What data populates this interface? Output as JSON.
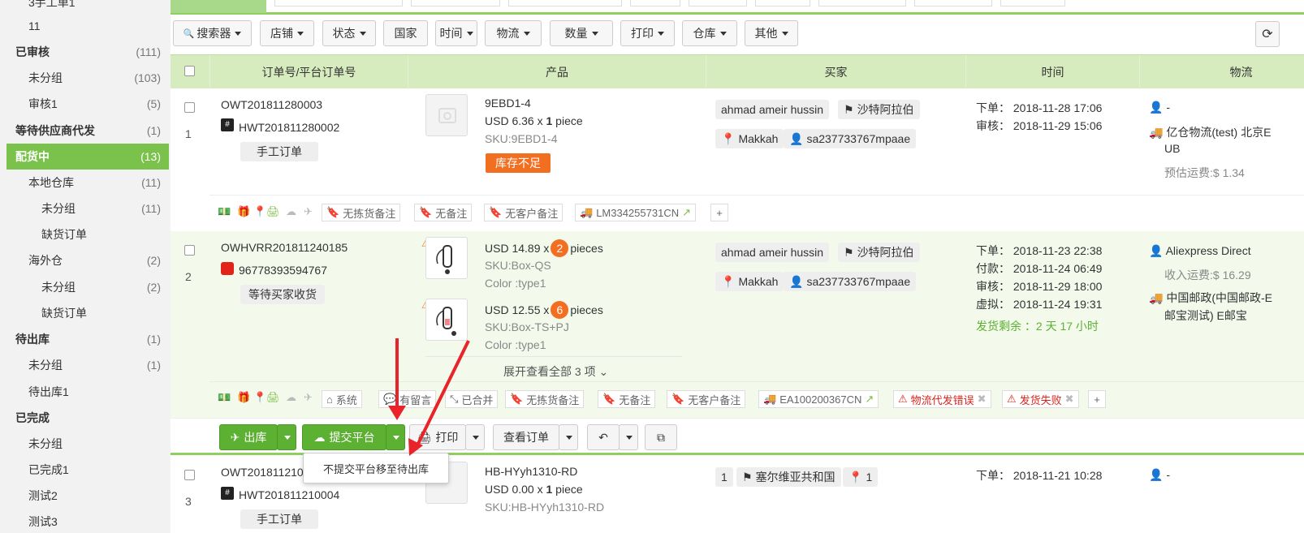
{
  "sidebar": {
    "items": [
      {
        "label": "3手工单1",
        "count": "",
        "level": 2
      },
      {
        "label": "11",
        "count": "",
        "level": 2
      },
      {
        "label": "已审核",
        "count": "(111)",
        "level": 1
      },
      {
        "label": "未分组",
        "count": "(103)",
        "level": 2
      },
      {
        "label": "审核1",
        "count": "(5)",
        "level": 2
      },
      {
        "label": "等待供应商代发",
        "count": "(1)",
        "level": 1
      },
      {
        "label": "配货中",
        "count": "(13)",
        "level": 1,
        "active": true
      },
      {
        "label": "本地仓库",
        "count": "(11)",
        "level": 2
      },
      {
        "label": "未分组",
        "count": "(11)",
        "level": 3
      },
      {
        "label": "缺货订单",
        "count": "",
        "level": 3
      },
      {
        "label": "海外仓",
        "count": "(2)",
        "level": 2
      },
      {
        "label": "未分组",
        "count": "(2)",
        "level": 3
      },
      {
        "label": "缺货订单",
        "count": "",
        "level": 3
      },
      {
        "label": "待出库",
        "count": "(1)",
        "level": 1
      },
      {
        "label": "未分组",
        "count": "(1)",
        "level": 2
      },
      {
        "label": "待出库1",
        "count": "",
        "level": 2
      },
      {
        "label": "已完成",
        "count": "",
        "level": 1
      },
      {
        "label": "未分组",
        "count": "",
        "level": 2
      },
      {
        "label": "已完成1",
        "count": "",
        "level": 2
      },
      {
        "label": "测试2",
        "count": "",
        "level": 2
      },
      {
        "label": "测试3",
        "count": "",
        "level": 2
      }
    ]
  },
  "filters": [
    "搜索器",
    "店铺",
    "状态",
    "国家",
    "时间",
    "物流",
    "数量",
    "打印",
    "仓库",
    "其他"
  ],
  "columns": [
    "订单号/平台订单号",
    "产品",
    "买家",
    "时间",
    "物流"
  ],
  "orders": [
    {
      "index": "1",
      "order_no": "OWT201811280003",
      "platform_no": "HWT201811280002",
      "type_tag": "手工订单",
      "products": [
        {
          "name": "9EBD1-4",
          "price": "USD 6.36 x",
          "qty": "1",
          "unit": "piece",
          "sku": "SKU:9EBD1-4",
          "stock_badge": "库存不足"
        }
      ],
      "buyer_name": "ahmad ameir hussin",
      "country": "沙特阿拉伯",
      "city": "Makkah",
      "buyer_id": "sa237733767mpaae",
      "times": [
        {
          "label": "下单：",
          "value": "2018-11-28 17:06"
        },
        {
          "label": "审核：",
          "value": "2018-11-29 15:06"
        }
      ],
      "logistics": {
        "user": "-",
        "carrier": "亿仓物流(test) 北京E",
        "carrier2": "UB",
        "fee": "预估运费:$ 1.34"
      },
      "notes": [
        "无拣货备注",
        "无备注",
        "无客户备注"
      ],
      "tracking": "LM334255731CN"
    },
    {
      "index": "2",
      "order_no": "OWHVRR201811240185",
      "platform_no": "96778393594767",
      "type_tag": "等待买家收货",
      "products": [
        {
          "price": "USD 14.89 x",
          "qty": "2",
          "unit": "pieces",
          "sku": "SKU:Box-QS",
          "color": "Color :type1"
        },
        {
          "price": "USD 12.55 x",
          "qty": "6",
          "unit": "pieces",
          "sku": "SKU:Box-TS+PJ",
          "color": "Color :type1"
        }
      ],
      "expand": "展开查看全部 3 项",
      "buyer_name": "ahmad ameir hussin",
      "country": "沙特阿拉伯",
      "city": "Makkah",
      "buyer_id": "sa237733767mpaae",
      "times": [
        {
          "label": "下单：",
          "value": "2018-11-23 22:38"
        },
        {
          "label": "付款：",
          "value": "2018-11-24 06:49"
        },
        {
          "label": "审核：",
          "value": "2018-11-29 18:00"
        },
        {
          "label": "虚拟：",
          "value": "2018-11-24 19:31"
        }
      ],
      "remaining": "发货剩余 ：2 天 17 小时",
      "logistics": {
        "user": "Aliexpress Direct",
        "fee": "收入运费:$ 16.29",
        "carrier": "中国邮政(中国邮政-E",
        "carrier2": "邮宝测试) E邮宝"
      },
      "notes": [
        "系统",
        "有留言",
        "已合并",
        "无拣货备注",
        "无备注",
        "无客户备注"
      ],
      "tracking": "EA100200367CN",
      "errors": [
        "物流代发错误",
        "发货失败"
      ]
    },
    {
      "index": "3",
      "order_no": "OWT201811210",
      "platform_no": "HWT201811210004",
      "type_tag": "手工订单",
      "products": [
        {
          "name": "HB-HYyh1310-RD",
          "price": "USD 0.00 x",
          "qty": "1",
          "unit": "piece",
          "sku": "SKU:HB-HYyh1310-RD"
        }
      ],
      "buyer_qty": "1",
      "country": "塞尔维亚共和国",
      "buyer_num": "1",
      "times": [
        {
          "label": "下单：",
          "value": "2018-11-21 10:28"
        }
      ],
      "logistics": {
        "user": "-"
      }
    }
  ],
  "actions": {
    "ship": "出库",
    "submit": "提交平台",
    "print": "打印",
    "view": "查看订单",
    "dropdown_item": "不提交平台移至待出库"
  },
  "colors": {
    "accent_green": "#7bc24d",
    "orange": "#f26f21",
    "red": "#d9261c",
    "arrow_red": "#e8242a"
  }
}
